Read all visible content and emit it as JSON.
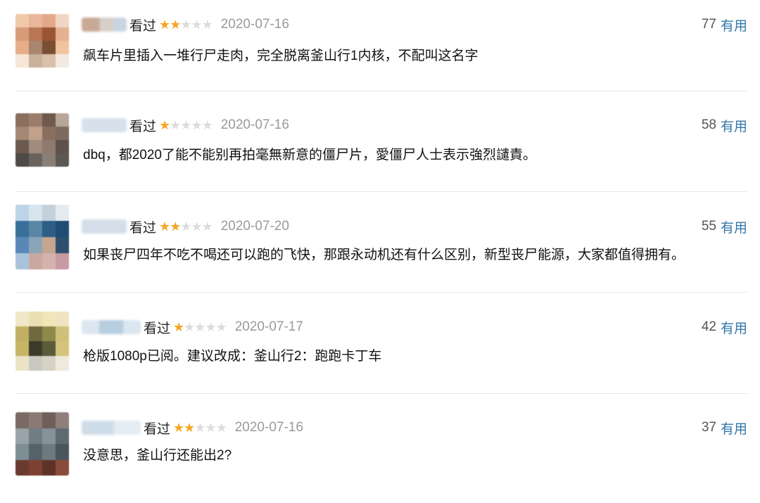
{
  "comments": [
    {
      "status": "看过",
      "rating": 2,
      "date": "2020-07-16",
      "votes": "77",
      "useful_label": "有用",
      "content": "飙车片里插入一堆行尸走肉，完全脱离釜山行1内核，不配叫这名字"
    },
    {
      "status": "看过",
      "rating": 1,
      "date": "2020-07-16",
      "votes": "58",
      "useful_label": "有用",
      "content": "dbq，都2020了能不能别再拍毫無新意的僵尸片，愛僵尸人士表示強烈譴責。"
    },
    {
      "status": "看过",
      "rating": 2,
      "date": "2020-07-20",
      "votes": "55",
      "useful_label": "有用",
      "content": "如果丧尸四年不吃不喝还可以跑的飞快，那跟永动机还有什么区别，新型丧尸能源，大家都值得拥有。"
    },
    {
      "status": "看过",
      "rating": 1,
      "date": "2020-07-17",
      "votes": "42",
      "useful_label": "有用",
      "content": "枪版1080p已阅。建议改成：釜山行2：跑跑卡丁车"
    },
    {
      "status": "看过",
      "rating": 2,
      "date": "2020-07-16",
      "votes": "37",
      "useful_label": "有用",
      "content": "没意思，釜山行还能出2?"
    }
  ],
  "rating_max": 5,
  "colors": {
    "link": "#3377aa",
    "star_on": "#f5a623",
    "star_off": "#dcdcdc",
    "date": "#9a9a9a"
  },
  "icons": {
    "star": "star-icon"
  }
}
